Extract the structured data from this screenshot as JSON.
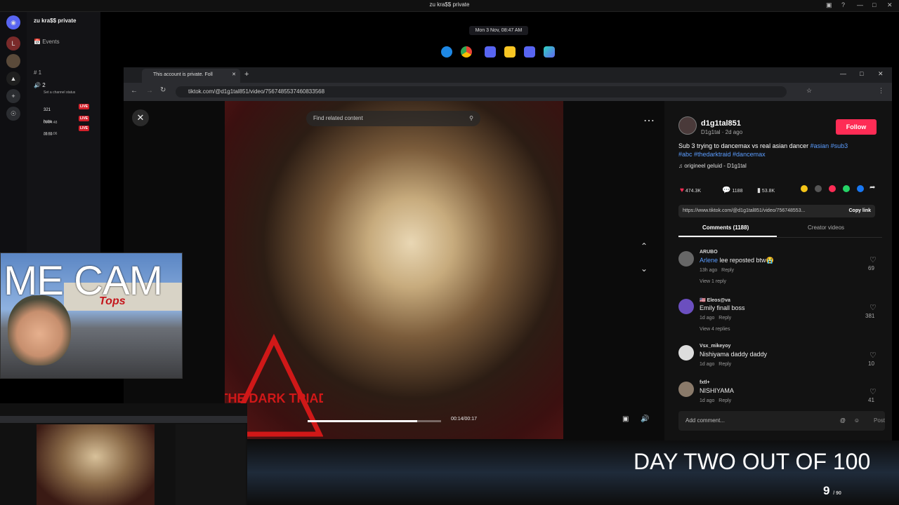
{
  "window": {
    "title": "zu kra$$ private"
  },
  "discord": {
    "server_name": "zu kra$$ private",
    "events_label": "Events",
    "channel_text": "1",
    "channel_voice": "2",
    "status_hint": "Set a channel status",
    "members": [
      {
        "name": "321",
        "time": "01:24:48",
        "badge": "LIVE"
      },
      {
        "name": "hate",
        "time": "06:59",
        "badge": "LIVE"
      },
      {
        "name": "",
        "time": "38:55:06",
        "badge": "LIVE"
      }
    ]
  },
  "clock": "Mon 3 Nov, 08:47 AM",
  "browser": {
    "tab_title": "This account is private. Foll",
    "url": "tiktok.com/@d1g1tal851/video/7567485537460833568"
  },
  "video": {
    "search_placeholder": "Find related content",
    "time": "00:14/00:17",
    "progress_fraction": 0.82,
    "overlay_logo_text": "THE DARK TRIAD"
  },
  "post": {
    "username": "d1g1tal851",
    "handle_date": "D1g1tal · 2d ago",
    "follow_label": "Follow",
    "caption_text": "Sub 3 trying to dancemax vs real asian dancer ",
    "caption_tags_1": "#asian #sub3",
    "caption_tags_2": "#abc #thedarktraid #dancemax",
    "sound": "origineel geluid - D1g1tal",
    "likes": "474.3K",
    "comments": "1188",
    "saves": "53.8K",
    "link": "https://www.tiktok.com/@d1g1tal851/video/756748553...",
    "copy_link_label": "Copy link",
    "tab_comments": "Comments (1188)",
    "tab_creator": "Creator videos",
    "add_comment_placeholder": "Add comment...",
    "post_label": "Post"
  },
  "comments": [
    {
      "user": "ARUBO",
      "text_prefix": "Arlene",
      "text": " lee reposted btw😭",
      "ago": "13h ago",
      "reply": "Reply",
      "replies": "View 1 reply",
      "likes": "69"
    },
    {
      "user": "🇺🇸 Eleos@va",
      "text_prefix": "",
      "text": "Emily finall boss",
      "ago": "1d ago",
      "reply": "Reply",
      "replies": "View 4 replies",
      "likes": "381"
    },
    {
      "user": "Vsx_mikeyoy",
      "text_prefix": "",
      "text": "Nishiyama daddy daddy",
      "ago": "1d ago",
      "reply": "Reply",
      "replies": "",
      "likes": "10"
    },
    {
      "user": "fxtl+",
      "text_prefix": "",
      "text": "NISHIYAMA",
      "ago": "1d ago",
      "reply": "Reply",
      "replies": "",
      "likes": "41"
    }
  ],
  "overlay": {
    "me_cam_label": "ME CAM",
    "tops_sign": "Tops",
    "day_counter": "DAY TWO OUT OF 100",
    "fraction_num": "9",
    "fraction_den": "/ 90"
  },
  "colors": {
    "follow": "#fe2c55",
    "live": "#d3202a",
    "tag": "#5b9dff"
  }
}
